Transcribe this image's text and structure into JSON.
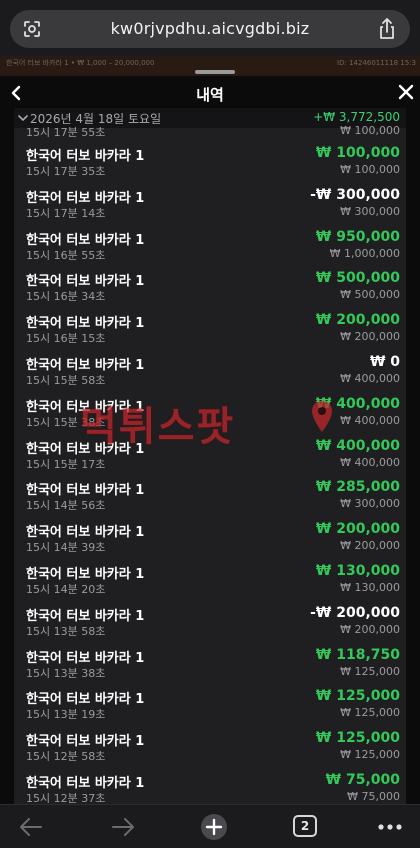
{
  "browser": {
    "url": "kw0rjvpdhu.aicvgdbi.biz",
    "open_tabs": "2",
    "icons": {
      "lens": "google-lens-icon",
      "share": "share-icon",
      "back": "arrow-left-icon",
      "forward": "arrow-right-icon",
      "new_tab": "plus-icon",
      "tabs": "tabs-icon",
      "more": "ellipsis-icon"
    }
  },
  "game_strip": {
    "left": "한국어 터보 바카라 1 • ₩ 1,000 – 20,000,000",
    "right": "ID: 14246011118 15:3"
  },
  "sheet": {
    "title": "내역",
    "icons": {
      "back": "chevron-left-icon",
      "close": "close-icon"
    }
  },
  "history": {
    "date": "2026년 4월 18일 토요일",
    "day_total": "+₩ 3,772,500",
    "partial_top": {
      "time": "15시 17분 55초",
      "bet": "₩ 100,000"
    },
    "rows": [
      {
        "name": "한국어 터보 바카라 1",
        "time": "15시 17분 35초",
        "amount": "₩ 100,000",
        "bet": "₩ 100,000",
        "kind": "win"
      },
      {
        "name": "한국어 터보 바카라 1",
        "time": "15시 17분 14초",
        "amount": "-₩ 300,000",
        "bet": "₩ 300,000",
        "kind": "lose"
      },
      {
        "name": "한국어 터보 바카라 1",
        "time": "15시 16분 55초",
        "amount": "₩ 950,000",
        "bet": "₩ 1,000,000",
        "kind": "win"
      },
      {
        "name": "한국어 터보 바카라 1",
        "time": "15시 16분 34초",
        "amount": "₩ 500,000",
        "bet": "₩ 500,000",
        "kind": "win"
      },
      {
        "name": "한국어 터보 바카라 1",
        "time": "15시 16분 15초",
        "amount": "₩ 200,000",
        "bet": "₩ 200,000",
        "kind": "win"
      },
      {
        "name": "한국어 터보 바카라 1",
        "time": "15시 15분 58초",
        "amount": "₩ 0",
        "bet": "₩ 400,000",
        "kind": "zero"
      },
      {
        "name": "한국어 터보 바카라 1",
        "time": "15시 15분 38초",
        "amount": "₩ 400,000",
        "bet": "₩ 400,000",
        "kind": "win"
      },
      {
        "name": "한국어 터보 바카라 1",
        "time": "15시 15분 17초",
        "amount": "₩ 400,000",
        "bet": "₩ 400,000",
        "kind": "win"
      },
      {
        "name": "한국어 터보 바카라 1",
        "time": "15시 14분 56초",
        "amount": "₩ 285,000",
        "bet": "₩ 300,000",
        "kind": "win"
      },
      {
        "name": "한국어 터보 바카라 1",
        "time": "15시 14분 39초",
        "amount": "₩ 200,000",
        "bet": "₩ 200,000",
        "kind": "win"
      },
      {
        "name": "한국어 터보 바카라 1",
        "time": "15시 14분 20초",
        "amount": "₩ 130,000",
        "bet": "₩ 130,000",
        "kind": "win"
      },
      {
        "name": "한국어 터보 바카라 1",
        "time": "15시 13분 58초",
        "amount": "-₩ 200,000",
        "bet": "₩ 200,000",
        "kind": "lose"
      },
      {
        "name": "한국어 터보 바카라 1",
        "time": "15시 13분 38초",
        "amount": "₩ 118,750",
        "bet": "₩ 125,000",
        "kind": "win"
      },
      {
        "name": "한국어 터보 바카라 1",
        "time": "15시 13분 19초",
        "amount": "₩ 125,000",
        "bet": "₩ 125,000",
        "kind": "win"
      },
      {
        "name": "한국어 터보 바카라 1",
        "time": "15시 12분 58초",
        "amount": "₩ 125,000",
        "bet": "₩ 125,000",
        "kind": "win"
      },
      {
        "name": "한국어 터보 바카라 1",
        "time": "15시 12분 37초",
        "amount": "₩ 75,000",
        "bet": "₩ 75,000",
        "kind": "win"
      }
    ]
  },
  "watermark": {
    "text": "먹튀스팟",
    "icon": "map-pin-icon"
  },
  "colors": {
    "win": "#34c85a",
    "lose": "#ffffff",
    "watermark": "#c0262c"
  }
}
